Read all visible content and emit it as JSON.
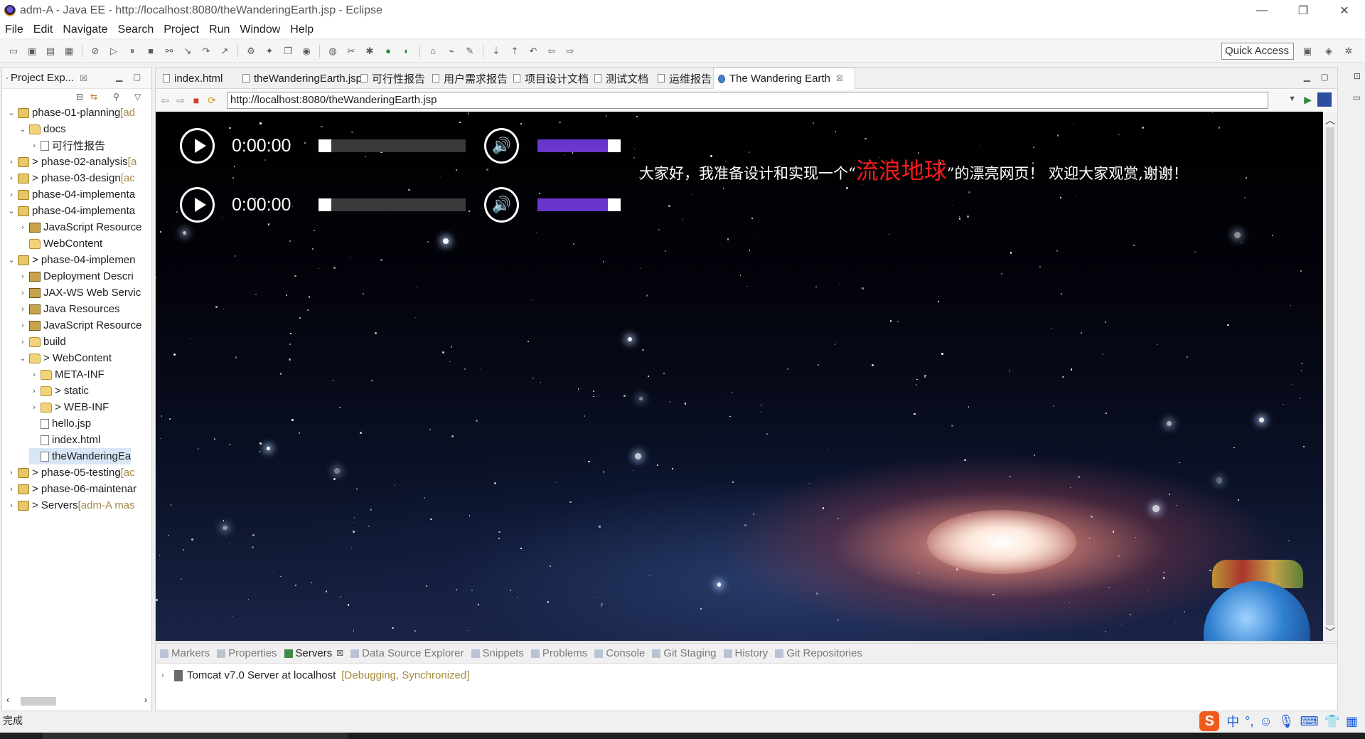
{
  "window": {
    "title": "adm-A - Java EE - http://localhost:8080/theWanderingEarth.jsp - Eclipse",
    "minimize": "—",
    "restore": "❐",
    "close": "✕"
  },
  "menu": [
    "File",
    "Edit",
    "Navigate",
    "Search",
    "Project",
    "Run",
    "Window",
    "Help"
  ],
  "toolbar": {
    "quick_access": "Quick Access"
  },
  "explorer": {
    "title": "Project Exp...",
    "close": "☒",
    "tree": [
      {
        "label": "phase-01-planning",
        "dec": " [ad",
        "icon": "proj",
        "twisty": "v",
        "indent": 0
      },
      {
        "label": "docs",
        "icon": "fold",
        "twisty": "v",
        "indent": 1
      },
      {
        "label": "可行性报告",
        "icon": "file",
        "twisty": ">",
        "indent": 2
      },
      {
        "label": "> phase-02-analysis",
        "dec": " [a",
        "icon": "proj",
        "twisty": ">",
        "indent": 0
      },
      {
        "label": "> phase-03-design",
        "dec": " [ac",
        "icon": "proj",
        "twisty": ">",
        "indent": 0
      },
      {
        "label": "phase-04-implementa",
        "icon": "proj",
        "twisty": ">",
        "indent": 0
      },
      {
        "label": "phase-04-implementa",
        "icon": "proj",
        "twisty": "v",
        "indent": 0
      },
      {
        "label": "JavaScript Resource",
        "icon": "lib",
        "twisty": ">",
        "indent": 1
      },
      {
        "label": "WebContent",
        "icon": "fold",
        "twisty": "",
        "indent": 1
      },
      {
        "label": "> phase-04-implemen",
        "icon": "proj",
        "twisty": "v",
        "indent": 0
      },
      {
        "label": "Deployment Descri",
        "icon": "lib",
        "twisty": ">",
        "indent": 1
      },
      {
        "label": "JAX-WS Web Servic",
        "icon": "lib",
        "twisty": ">",
        "indent": 1
      },
      {
        "label": "Java Resources",
        "icon": "lib",
        "twisty": ">",
        "indent": 1
      },
      {
        "label": "JavaScript Resource",
        "icon": "lib",
        "twisty": ">",
        "indent": 1
      },
      {
        "label": "build",
        "icon": "fold",
        "twisty": ">",
        "indent": 1
      },
      {
        "label": "> WebContent",
        "icon": "fold",
        "twisty": "v",
        "indent": 1
      },
      {
        "label": "META-INF",
        "icon": "fold",
        "twisty": ">",
        "indent": 2
      },
      {
        "label": "> static",
        "icon": "fold",
        "twisty": ">",
        "indent": 2
      },
      {
        "label": "> WEB-INF",
        "icon": "fold",
        "twisty": ">",
        "indent": 2
      },
      {
        "label": "hello.jsp",
        "icon": "file",
        "twisty": "",
        "indent": 2
      },
      {
        "label": "index.html",
        "icon": "file",
        "twisty": "",
        "indent": 2
      },
      {
        "label": "theWanderingEa",
        "icon": "file",
        "twisty": "",
        "indent": 2,
        "selected": true
      },
      {
        "label": "> phase-05-testing",
        "dec": " [ac",
        "icon": "proj",
        "twisty": ">",
        "indent": 0
      },
      {
        "label": "> phase-06-maintenar",
        "icon": "proj",
        "twisty": ">",
        "indent": 0
      },
      {
        "label": "> Servers",
        "dec": " [adm-A mas",
        "icon": "proj",
        "twisty": ">",
        "indent": 0
      }
    ]
  },
  "editor": {
    "tabs": [
      {
        "label": "index.html"
      },
      {
        "label": "theWanderingEarth.jsp"
      },
      {
        "label": "可行性报告"
      },
      {
        "label": "用户需求报告"
      },
      {
        "label": "项目设计文档"
      },
      {
        "label": "测试文档"
      },
      {
        "label": "运维报告"
      },
      {
        "label": "The Wandering Earth",
        "active": true
      }
    ],
    "url": "http://localhost:8080/theWanderingEarth.jsp"
  },
  "page": {
    "players": [
      {
        "time": "0:00:00",
        "progress": 0,
        "volume": 1.0
      },
      {
        "time": "0:00:00",
        "progress": 0,
        "volume": 1.0
      }
    ],
    "greeting": {
      "before": "大家好，我准备设计和实现一个“",
      "highlight": "流浪地球",
      "after": "”的漂亮网页！ 欢迎大家观赏,谢谢！"
    }
  },
  "bottom": {
    "tabs": [
      {
        "label": "Markers"
      },
      {
        "label": "Properties"
      },
      {
        "label": "Servers",
        "active": true
      },
      {
        "label": "Data Source Explorer"
      },
      {
        "label": "Snippets"
      },
      {
        "label": "Problems"
      },
      {
        "label": "Console"
      },
      {
        "label": "Git Staging"
      },
      {
        "label": "History"
      },
      {
        "label": "Git Repositories"
      }
    ],
    "server": {
      "name": "Tomcat v7.0 Server at localhost",
      "status": "[Debugging, Synchronized]"
    }
  },
  "status": {
    "text": "完成"
  },
  "ime": {
    "logo": "S",
    "lang": "中"
  }
}
